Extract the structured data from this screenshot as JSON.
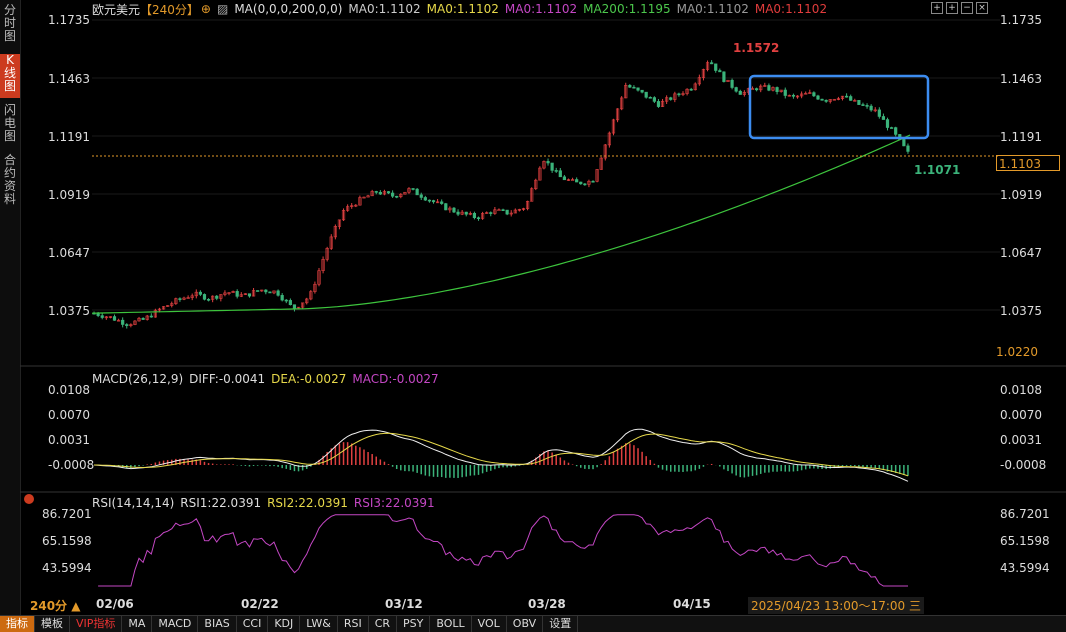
{
  "sidebar": {
    "items": [
      {
        "label": "分时图",
        "active": false
      },
      {
        "label": "K线图",
        "active": true
      },
      {
        "label": "闪电图",
        "active": false
      },
      {
        "label": "合约资料",
        "active": false
      }
    ]
  },
  "legend": {
    "symbol": "欧元美元",
    "period": "【240分】",
    "ma_params": "MA(0,0,0,200,0,0)",
    "ma_values": [
      {
        "text": "MA0:1.1102",
        "color": "#cccccc"
      },
      {
        "text": "MA0:1.1102",
        "color": "#e6d84a"
      },
      {
        "text": "MA0:1.1102",
        "color": "#c447c4"
      },
      {
        "text": "MA200:1.1195",
        "color": "#4cc74c"
      },
      {
        "text": "MA0:1.1102",
        "color": "#999999"
      },
      {
        "text": "MA0:1.1102",
        "color": "#e03c3c"
      }
    ]
  },
  "price_axis": {
    "labels": [
      "1.1735",
      "1.1463",
      "1.1191",
      "1.0919",
      "1.0647",
      "1.0375"
    ],
    "current_price": "1.1103",
    "bottom_price": "1.0220"
  },
  "annotations": {
    "high": "1.1572",
    "low": "1.1071"
  },
  "macd": {
    "title": "MACD(26,12,9)",
    "diff": "DIFF:-0.0041",
    "dea": "DEA:-0.0027",
    "macd": "MACD:-0.0027",
    "axis": [
      "0.0108",
      "0.0070",
      "0.0031",
      "-0.0008"
    ]
  },
  "rsi": {
    "title": "RSI(14,14,14)",
    "rsi1": "RSI1:22.0391",
    "rsi2": "RSI2:22.0391",
    "rsi3": "RSI3:22.0391",
    "axis": [
      "86.7201",
      "65.1598",
      "43.5994"
    ]
  },
  "dates": {
    "period_label": "240分 ▲",
    "ticks": [
      "02/06",
      "02/22",
      "03/12",
      "03/28",
      "04/15"
    ],
    "cursor": "2025/04/23 13:00～17:00 三"
  },
  "toolbar": [
    "指标",
    "模板",
    "VIP指标",
    "MA",
    "MACD",
    "BIAS",
    "CCI",
    "KDJ",
    "LW&",
    "RSI",
    "CR",
    "PSY",
    "BOLL",
    "VOL",
    "OBV",
    "设置"
  ],
  "colors": {
    "up": "#e04040",
    "down": "#3bb37a",
    "ma200": "#3dc43d",
    "highlight": "#3c8cf0",
    "price_line": "#e39a2a"
  },
  "chart_data": {
    "type": "candlestick",
    "price_ticks": [
      1.1735,
      1.1463,
      1.1191,
      1.0919,
      1.0647,
      1.0375
    ],
    "ylim": [
      1.022,
      1.1735
    ],
    "high": 1.1572,
    "low": 1.1071,
    "last": 1.1103,
    "close_path": [
      1.036,
      1.034,
      1.031,
      1.033,
      1.038,
      1.042,
      1.045,
      1.043,
      1.046,
      1.044,
      1.047,
      1.046,
      1.038,
      1.044,
      1.066,
      1.084,
      1.089,
      1.093,
      1.091,
      1.094,
      1.09,
      1.086,
      1.083,
      1.081,
      1.084,
      1.083,
      1.086,
      1.109,
      1.1,
      1.097,
      1.098,
      1.12,
      1.143,
      1.139,
      1.134,
      1.138,
      1.142,
      1.155,
      1.145,
      1.139,
      1.142,
      1.141,
      1.137,
      1.139,
      1.136,
      1.138,
      1.134,
      1.131,
      1.122,
      1.111
    ]
  }
}
